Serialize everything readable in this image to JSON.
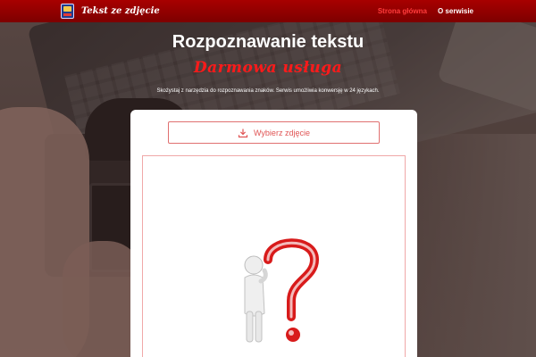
{
  "navbar": {
    "logo_icon": "app-logo-icon",
    "brand": "Tekst ze zdjęcie",
    "links": [
      {
        "label": "Strona główna",
        "active": true
      },
      {
        "label": "O serwisie",
        "active": false
      }
    ],
    "accent": "#ff3c3c"
  },
  "hero": {
    "title": "Rozpoznawanie tekstu",
    "subtitle": "Darmowa usługa",
    "description": "Skożystaj z narzędzia do rozpoznawania znaków. Serwis umożliwia konwersję w 24 językach."
  },
  "upload": {
    "label": "Wybierz zdjęcie",
    "icon": "download-icon"
  },
  "preview": {
    "image": "question-mark-figure-illustration"
  },
  "colors": {
    "nav_bg": "#8e0000",
    "subtitle": "#ff1a1a",
    "button_text": "#e05454"
  }
}
